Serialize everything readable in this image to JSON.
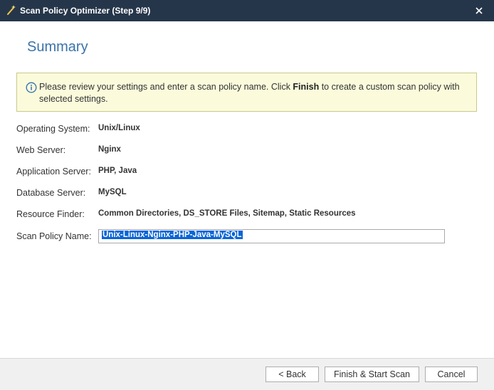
{
  "window": {
    "title": "Scan Policy Optimizer (Step 9/9)",
    "icon": "magic-wand-icon",
    "close_icon": "close-icon",
    "titlebar_color": "#26364a"
  },
  "page": {
    "title": "Summary",
    "title_color": "#3a73a8"
  },
  "info": {
    "icon": "info-icon",
    "text_before": "Please review your settings and enter a scan policy name. Click ",
    "text_bold": "Finish",
    "text_after": " to create a custom scan policy with selected settings.",
    "background": "#fbfbdc"
  },
  "summary": {
    "operating_system": {
      "label": "Operating System:",
      "value": "Unix/Linux"
    },
    "web_server": {
      "label": "Web Server:",
      "value": "Nginx"
    },
    "application_server": {
      "label": "Application Server:",
      "value": "PHP, Java"
    },
    "database_server": {
      "label": "Database Server:",
      "value": "MySQL"
    },
    "resource_finder": {
      "label": "Resource Finder:",
      "value": "Common Directories, DS_STORE Files, Sitemap, Static Resources"
    },
    "scan_policy_name": {
      "label": "Scan Policy Name:",
      "value": "Unix-Linux-Nginx-PHP-Java-MySQL"
    }
  },
  "buttons": {
    "back": "< Back",
    "finish": "Finish & Start Scan",
    "cancel": "Cancel"
  }
}
